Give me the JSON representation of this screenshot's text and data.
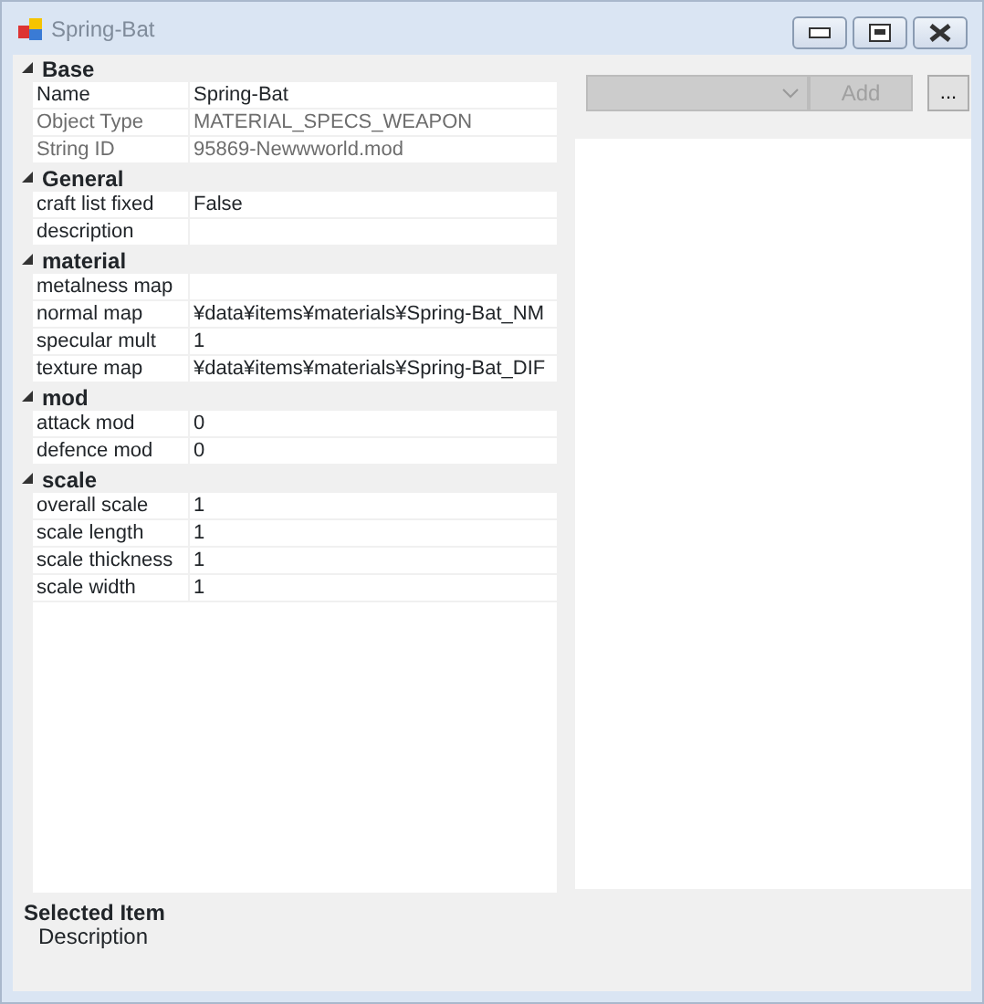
{
  "window": {
    "title": "Spring-Bat"
  },
  "property_grid": {
    "categories": [
      {
        "name": "Base",
        "expanded": true,
        "properties": [
          {
            "name": "Name",
            "value": "Spring-Bat",
            "readonly": false
          },
          {
            "name": "Object Type",
            "value": "MATERIAL_SPECS_WEAPON",
            "readonly": true
          },
          {
            "name": "String ID",
            "value": "95869-Newwworld.mod",
            "readonly": true
          }
        ]
      },
      {
        "name": "General",
        "expanded": true,
        "properties": [
          {
            "name": "craft list fixed",
            "value": "False",
            "readonly": false
          },
          {
            "name": "description",
            "readonly": false
          }
        ]
      },
      {
        "name": "material",
        "expanded": true,
        "properties": [
          {
            "name": "metalness map",
            "readonly": false
          },
          {
            "name": "normal map",
            "value": "¥data¥items¥materials¥Spring-Bat_NM",
            "readonly": false
          },
          {
            "name": "specular mult",
            "value": "1",
            "readonly": false
          },
          {
            "name": "texture map",
            "value": "¥data¥items¥materials¥Spring-Bat_DIF",
            "readonly": false
          }
        ]
      },
      {
        "name": "mod",
        "expanded": true,
        "properties": [
          {
            "name": "attack mod",
            "value": "0",
            "readonly": false
          },
          {
            "name": "defence mod",
            "value": "0",
            "readonly": false
          }
        ]
      },
      {
        "name": "scale",
        "expanded": true,
        "properties": [
          {
            "name": "overall scale",
            "value": "1",
            "readonly": false
          },
          {
            "name": "scale length",
            "value": "1",
            "readonly": false
          },
          {
            "name": "scale thickness",
            "value": "1",
            "readonly": false
          },
          {
            "name": "scale width",
            "value": "1",
            "readonly": false
          }
        ]
      }
    ]
  },
  "toolbar": {
    "dropdown": {
      "disabled": true
    },
    "add_button": {
      "label": "Add",
      "disabled": true
    },
    "browse_button": {
      "label": "...",
      "disabled": false
    }
  },
  "help": {
    "title": "Selected Item",
    "description": "Description"
  }
}
